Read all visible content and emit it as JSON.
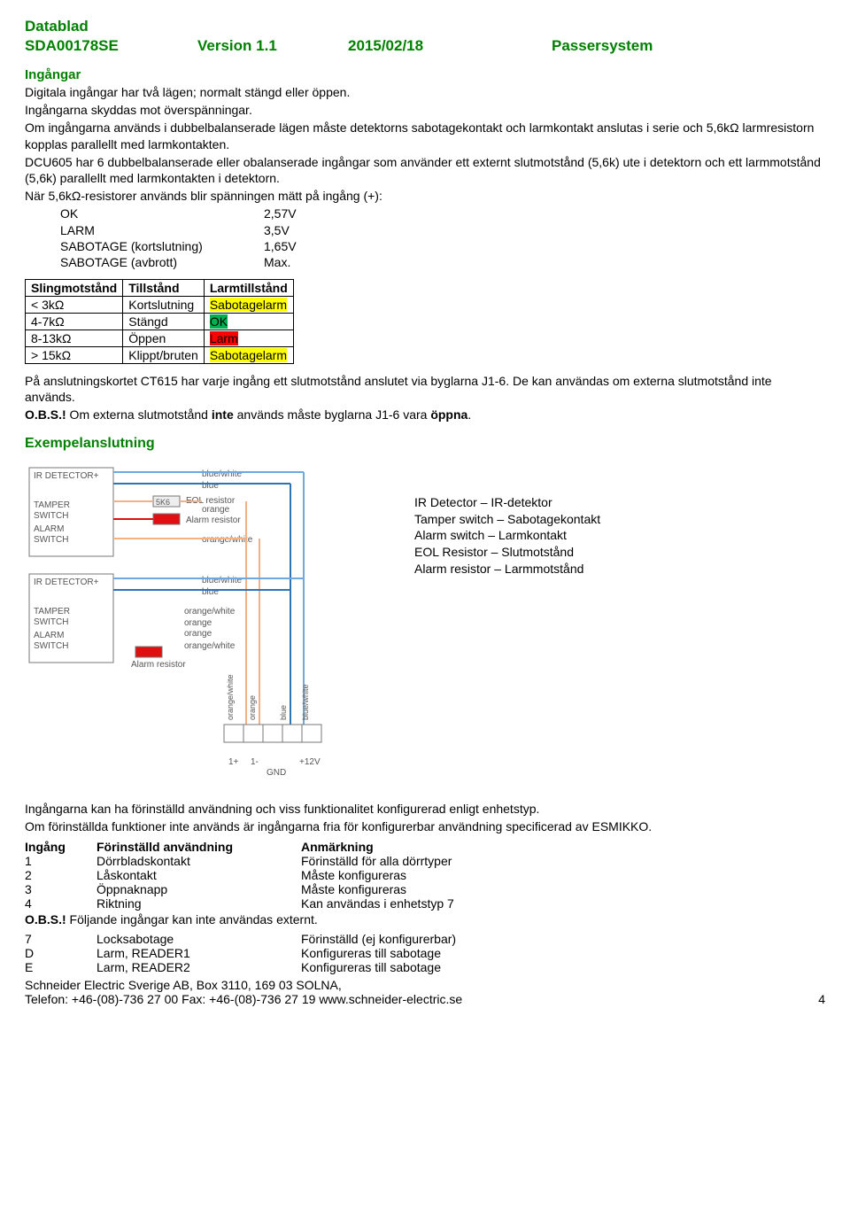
{
  "header": {
    "title": "Datablad",
    "code": "SDA00178SE",
    "version": "Version 1.1",
    "date": "2015/02/18",
    "system": "Passersystem"
  },
  "section1": {
    "title": "Ingångar",
    "p1": "Digitala ingångar har två lägen; normalt stängd eller öppen.",
    "p2": "Ingångarna skyddas mot överspänningar.",
    "p3": "Om ingångarna används i dubbelbalanserade lägen måste detektorns sabotagekontakt och larmkontakt anslutas i serie och 5,6kΩ larmresistorn kopplas parallellt med larmkontakten.",
    "p4": "DCU605 har 6 dubbelbalanserade eller obalanserade ingångar som använder ett externt slutmotstånd (5,6k) ute i detektorn och ett larmmotstånd (5,6k) parallellt med larmkontakten i detektorn.",
    "p5": "När 5,6kΩ-resistorer används blir spänningen mätt på ingång (+):",
    "measures": [
      {
        "k": "OK",
        "v": "2,57V"
      },
      {
        "k": "LARM",
        "v": "3,5V"
      },
      {
        "k": "SABOTAGE (kortslutning)",
        "v": "1,65V"
      },
      {
        "k": "SABOTAGE (avbrott)",
        "v": "Max."
      }
    ]
  },
  "stateTable": {
    "headers": [
      "Slingmotstånd",
      "Tillstånd",
      "Larmtillstånd"
    ],
    "rows": [
      {
        "a": "< 3kΩ",
        "b": "Kortslutning",
        "c": "Sabotagelarm",
        "hl": "yellow"
      },
      {
        "a": "4-7kΩ",
        "b": "Stängd",
        "c": "OK",
        "hl": "green"
      },
      {
        "a": "8-13kΩ",
        "b": "Öppen",
        "c": "Larm",
        "hl": "red"
      },
      {
        "a": "> 15kΩ",
        "b": "Klippt/bruten",
        "c": "Sabotagelarm",
        "hl": "yellow"
      }
    ]
  },
  "afterTable": {
    "p1": "På anslutningskortet CT615 har varje ingång ett slutmotstånd anslutet via byglarna J1-6. De kan användas om externa slutmotstånd inte används.",
    "obs_label": "O.B.S.!",
    "obs_text": " Om externa slutmotstånd ",
    "obs_bold": "inte",
    "obs_tail": " används måste byglarna J1-6 vara ",
    "obs_bold2": "öppna",
    "obs_dot": "."
  },
  "example": {
    "title": "Exempelanslutning",
    "legend": [
      "IR Detector – IR-detektor",
      "Tamper switch – Sabotagekontakt",
      "Alarm switch – Larmkontakt",
      "EOL Resistor – Slutmotstånd",
      "Alarm resistor – Larmmotstånd"
    ],
    "diagram": {
      "labels": {
        "ir": "IR DETECTOR+",
        "tamper": "TAMPER",
        "switch": "SWITCH",
        "alarm": "ALARM",
        "blue": "blue",
        "blue_white": "blue/white",
        "eol": "EOL resistor",
        "5k6": "5K6",
        "alarm_res": "Alarm resistor",
        "orange": "orange",
        "orange_white": "orange/white",
        "1p": "1+",
        "1m": "1-",
        "gnd": "GND",
        "p12v": "+12V"
      }
    }
  },
  "preconf": {
    "p1": "Ingångarna kan ha förinställd användning och viss funktionalitet konfigurerad enligt enhetstyp.",
    "p2": "Om förinställda funktioner inte används är ingångarna fria för konfigurerbar användning specificerad av ESMIKKO.",
    "headers": [
      "Ingång",
      "Förinställd användning",
      "Anmärkning"
    ],
    "rows": [
      {
        "a": "1",
        "b": "Dörrbladskontakt",
        "c": "Förinställd för alla dörrtyper"
      },
      {
        "a": "2",
        "b": "Låskontakt",
        "c": "Måste konfigureras"
      },
      {
        "a": "3",
        "b": "Öppnaknapp",
        "c": "Måste konfigureras"
      },
      {
        "a": "4",
        "b": "Riktning",
        "c": "Kan användas i enhetstyp 7"
      }
    ],
    "obs_label": "O.B.S.!",
    "obs_text": " Följande ingångar kan inte användas externt.",
    "rows2": [
      {
        "a": "7",
        "b": "Locksabotage",
        "c": "Förinställd (ej konfigurerbar)"
      },
      {
        "a": "D",
        "b": "Larm, READER1",
        "c": "Konfigureras till sabotage"
      },
      {
        "a": "E",
        "b": "Larm, READER2",
        "c": "Konfigureras till sabotage"
      }
    ]
  },
  "footer": {
    "l1": "Schneider Electric Sverige AB, Box 3110, 169 03 SOLNA,",
    "l2a": "Telefon: +46-(08)-736 27 00 Fax: +46-(08)-736 27 19 www.schneider-electric.se",
    "l2b": "4"
  }
}
